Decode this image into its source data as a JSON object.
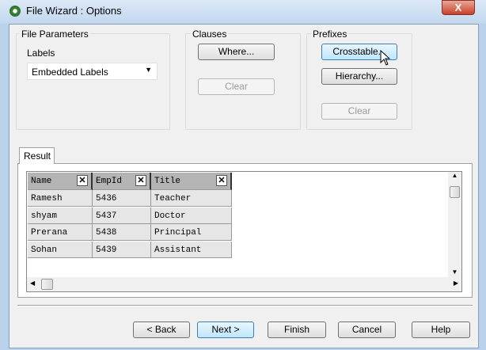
{
  "window": {
    "title": "File Wizard : Options",
    "close_label": "X"
  },
  "file_parameters": {
    "group_label": "File Parameters",
    "labels_label": "Labels",
    "labels_value": "Embedded Labels"
  },
  "clauses": {
    "group_label": "Clauses",
    "where_label": "Where...",
    "clear_label": "Clear"
  },
  "prefixes": {
    "group_label": "Prefixes",
    "crosstable_label": "Crosstable...",
    "hierarchy_label": "Hierarchy...",
    "clear_label": "Clear"
  },
  "result": {
    "tab_label": "Result",
    "columns": [
      "Name",
      "EmpId",
      "Title"
    ],
    "rows": [
      [
        "Ramesh",
        "5436",
        "Teacher"
      ],
      [
        "shyam",
        "5437",
        "Doctor"
      ],
      [
        "Prerana",
        "5438",
        "Principal"
      ],
      [
        "Sohan",
        "5439",
        "Assistant"
      ]
    ]
  },
  "footer": {
    "back": "< Back",
    "next": "Next >",
    "finish": "Finish",
    "cancel": "Cancel",
    "help": "Help"
  }
}
